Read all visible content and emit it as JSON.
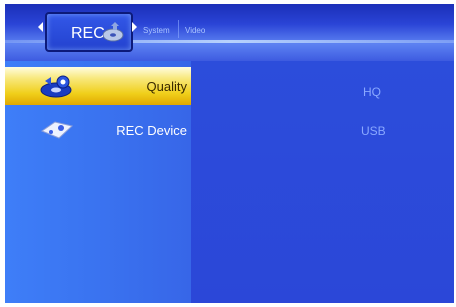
{
  "header": {
    "active_tab": "REC",
    "tabs": [
      "System",
      "Video"
    ]
  },
  "menu": [
    {
      "label": "Quality",
      "value": "HQ",
      "icon": "quality-icon",
      "selected": true
    },
    {
      "label": "REC Device",
      "value": "USB",
      "icon": "rec-device-icon",
      "selected": false
    }
  ],
  "colors": {
    "background": "#2c48dc",
    "left_panel": "#3a73f0",
    "highlight": "#f0cf1a",
    "value_text": "#8aa8ff"
  }
}
